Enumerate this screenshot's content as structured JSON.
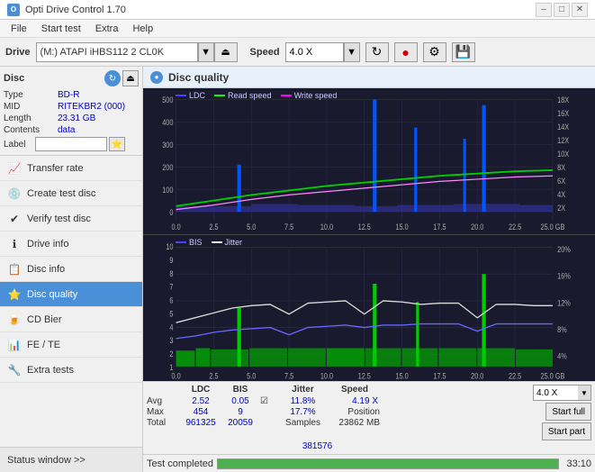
{
  "titleBar": {
    "title": "Opti Drive Control 1.70",
    "minimize": "–",
    "maximize": "□",
    "close": "✕"
  },
  "menu": {
    "items": [
      "File",
      "Start test",
      "Extra",
      "Help"
    ]
  },
  "drive": {
    "label": "Drive",
    "selected": "(M:)  ATAPI iHBS112  2 CL0K",
    "speedLabel": "Speed",
    "speedSelected": "4.0 X"
  },
  "disc": {
    "title": "Disc",
    "type_label": "Type",
    "type_val": "BD-R",
    "mid_label": "MID",
    "mid_val": "RITEKBR2 (000)",
    "length_label": "Length",
    "length_val": "23.31 GB",
    "contents_label": "Contents",
    "contents_val": "data",
    "label_label": "Label",
    "label_val": ""
  },
  "nav": {
    "items": [
      {
        "id": "transfer-rate",
        "label": "Transfer rate",
        "icon": "📈"
      },
      {
        "id": "create-test-disc",
        "label": "Create test disc",
        "icon": "💿"
      },
      {
        "id": "verify-test-disc",
        "label": "Verify test disc",
        "icon": "✔"
      },
      {
        "id": "drive-info",
        "label": "Drive info",
        "icon": "ℹ"
      },
      {
        "id": "disc-info",
        "label": "Disc info",
        "icon": "📋"
      },
      {
        "id": "disc-quality",
        "label": "Disc quality",
        "icon": "⭐",
        "active": true
      },
      {
        "id": "cd-bier",
        "label": "CD Bier",
        "icon": "🍺"
      },
      {
        "id": "fe-te",
        "label": "FE / TE",
        "icon": "📊"
      },
      {
        "id": "extra-tests",
        "label": "Extra tests",
        "icon": "🔧"
      }
    ],
    "statusWindow": "Status window >>"
  },
  "chartHeader": "Disc quality",
  "chart1": {
    "title": "Disc quality",
    "legend": [
      {
        "label": "LDC",
        "color": "#4444ff"
      },
      {
        "label": "Read speed",
        "color": "#00ff00"
      },
      {
        "label": "Write speed",
        "color": "#ff00ff"
      }
    ],
    "yLeft": [
      "500",
      "400",
      "300",
      "200",
      "100",
      "0"
    ],
    "yRight": [
      "18X",
      "16X",
      "14X",
      "12X",
      "10X",
      "8X",
      "6X",
      "4X",
      "2X"
    ],
    "xLabels": [
      "0.0",
      "2.5",
      "5.0",
      "7.5",
      "10.0",
      "12.5",
      "15.0",
      "17.5",
      "20.0",
      "22.5",
      "25.0 GB"
    ]
  },
  "chart2": {
    "legend": [
      {
        "label": "BIS",
        "color": "#4444ff"
      },
      {
        "label": "Jitter",
        "color": "#ffffff"
      }
    ],
    "yLeft": [
      "10",
      "9",
      "8",
      "7",
      "6",
      "5",
      "4",
      "3",
      "2",
      "1"
    ],
    "yRight": [
      "20%",
      "16%",
      "12%",
      "8%",
      "4%"
    ],
    "xLabels": [
      "0.0",
      "2.5",
      "5.0",
      "7.5",
      "10.0",
      "12.5",
      "15.0",
      "17.5",
      "20.0",
      "22.5",
      "25.0 GB"
    ]
  },
  "stats": {
    "col_headers": [
      "",
      "LDC",
      "BIS",
      "",
      "Jitter",
      "Speed",
      ""
    ],
    "avg_label": "Avg",
    "avg_ldc": "2.52",
    "avg_bis": "0.05",
    "avg_jitter": "11.8%",
    "avg_speed": "4.19 X",
    "max_label": "Max",
    "max_ldc": "454",
    "max_bis": "9",
    "max_jitter": "17.7%",
    "position_label": "Position",
    "position_val": "23862 MB",
    "total_label": "Total",
    "total_ldc": "961325",
    "total_bis": "20059",
    "samples_label": "Samples",
    "samples_val": "381576",
    "speed_select": "4.0 X",
    "btn_full": "Start full",
    "btn_part": "Start part",
    "jitter_check": "✓",
    "jitter_label": "Jitter"
  },
  "statusBar": {
    "status": "Test completed",
    "progress": 100,
    "time": "33:10"
  }
}
